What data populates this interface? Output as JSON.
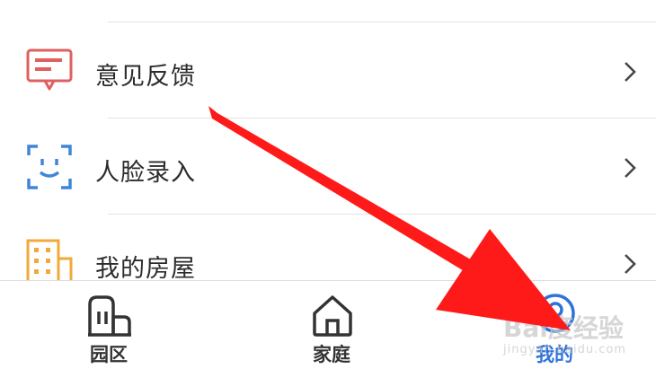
{
  "menu": {
    "items": [
      {
        "label": "意见反馈",
        "icon": "feedback-icon",
        "icon_color": "#e06060"
      },
      {
        "label": "人脸录入",
        "icon": "face-scan-icon",
        "icon_color": "#3f86d8"
      },
      {
        "label": "我的房屋",
        "icon": "building-icon",
        "icon_color": "#f2a93b"
      }
    ]
  },
  "tabbar": {
    "tabs": [
      {
        "label": "园区",
        "icon": "park-building-icon",
        "active": false
      },
      {
        "label": "家庭",
        "icon": "home-icon",
        "active": false
      },
      {
        "label": "我的",
        "icon": "profile-icon",
        "active": true
      }
    ],
    "active_color": "#2f73d9"
  },
  "overlay": {
    "arrow_color": "#ff1a1a",
    "watermark_text": "Bai度经验",
    "watermark_url": "jingyan.baidu.com"
  }
}
